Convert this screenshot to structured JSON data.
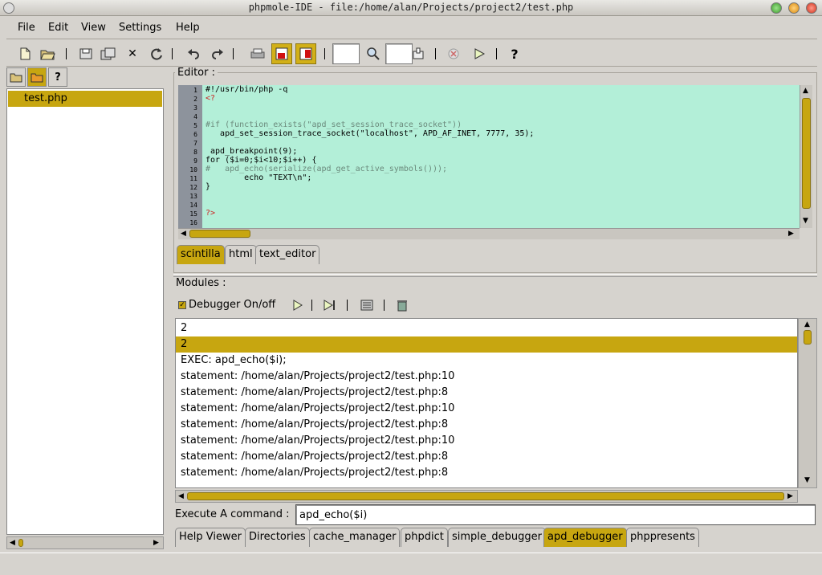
{
  "window": {
    "title": "phpmole-IDE - file:/home/alan/Projects/project2/test.php"
  },
  "menubar": {
    "items": [
      "File",
      "Edit",
      "View",
      "Settings",
      "Help"
    ]
  },
  "toolbar": {
    "icons": [
      "new-file-icon",
      "open-file-icon",
      "save-icon",
      "save-all-icon",
      "close-icon",
      "reload-icon",
      "undo-icon",
      "redo-icon",
      "print-icon",
      "split-view-icon",
      "split-view-alt-icon",
      "zoom-icon",
      "goto-icon",
      "stop-icon",
      "run-icon",
      "help-icon"
    ],
    "help_label": "?",
    "close_label": "✕"
  },
  "left_panel": {
    "tab_help_label": "?",
    "files": [
      "test.php"
    ]
  },
  "editor": {
    "label": "Editor :",
    "line_numbers": [
      "1",
      "2",
      "3",
      "4",
      "5",
      "6",
      "7",
      "8",
      "9",
      "10",
      "11",
      "12",
      "13",
      "14",
      "15",
      "16"
    ],
    "lines": [
      "#!/usr/bin/php -q",
      "<?",
      "",
      "",
      "#if (function_exists(\"apd_set_session_trace_socket\"))",
      "   apd_set_session_trace_socket(\"localhost\", APD_AF_INET, 7777, 35);",
      "",
      " apd_breakpoint(9);",
      "for ($i=0;$i<10;$i++) {",
      "#   apd_echo(serialize(apd_get_active_symbols()));",
      "        echo \"TEXT\\n\";",
      "}",
      "",
      "",
      "?>",
      ""
    ],
    "tabs": [
      "scintilla",
      "html",
      "text_editor"
    ],
    "active_tab": "scintilla"
  },
  "modules": {
    "label": "Modules :",
    "debugger_toggle_label": "Debugger On/off",
    "debugger_checked": true,
    "output_lines": [
      "2",
      "2",
      "EXEC: apd_echo($i);",
      "statement: /home/alan/Projects/project2/test.php:10",
      "statement: /home/alan/Projects/project2/test.php:8",
      "statement: /home/alan/Projects/project2/test.php:10",
      "statement: /home/alan/Projects/project2/test.php:8",
      "statement: /home/alan/Projects/project2/test.php:10",
      "statement: /home/alan/Projects/project2/test.php:8",
      "statement: /home/alan/Projects/project2/test.php:8"
    ],
    "selected_index": 1,
    "command_label": "Execute A command :",
    "command_value": "apd_echo($i)",
    "bottom_tabs": [
      "Help Viewer",
      "Directories",
      "cache_manager",
      "phpdict",
      "simple_debugger",
      "apd_debugger",
      "phppresents"
    ],
    "active_bottom_tab": "apd_debugger"
  },
  "colors": {
    "accent": "#c7a610",
    "editor_bg": "#b3efd8",
    "window_bg": "#d6d3ce"
  }
}
